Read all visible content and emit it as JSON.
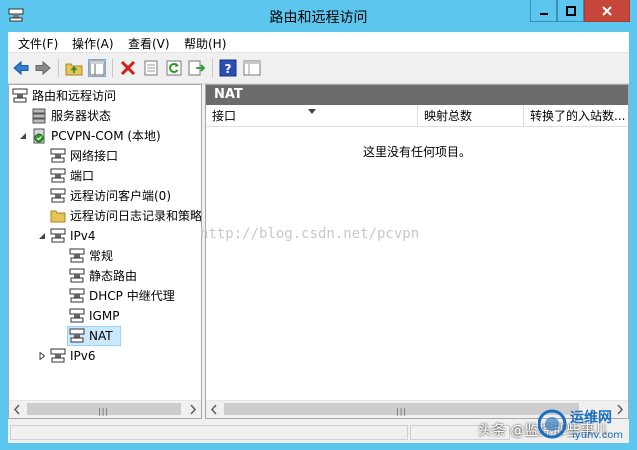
{
  "window": {
    "title": "路由和远程访问"
  },
  "menubar": {
    "items": [
      {
        "label": "文件(F)"
      },
      {
        "label": "操作(A)"
      },
      {
        "label": "查看(V)"
      },
      {
        "label": "帮助(H)"
      }
    ]
  },
  "toolbar": {
    "icons": [
      "back-arrow-icon",
      "forward-arrow-icon",
      "up-folder-icon",
      "show-hide-tree-icon",
      "delete-icon",
      "properties-icon",
      "refresh-icon",
      "export-list-icon",
      "help-icon",
      "console-pane-icon"
    ]
  },
  "tree": {
    "root": "路由和远程访问",
    "server_status": "服务器状态",
    "server": "PCVPN-COM (本地)",
    "network_interfaces": "网络接口",
    "ports": "端口",
    "remote_clients": "远程访问客户端(0)",
    "remote_logging": "远程访问日志记录和策略",
    "ipv4": "IPv4",
    "general": "常规",
    "static_routes": "静态路由",
    "dhcp_relay": "DHCP 中继代理",
    "igmp": "IGMP",
    "nat": "NAT",
    "ipv6": "IPv6"
  },
  "right_pane": {
    "header": "NAT",
    "columns": [
      "接口",
      "映射总数",
      "转换了的入站数..."
    ],
    "empty_message": "这里没有任何项目。"
  },
  "overlay": {
    "watermark": "http://blog.csdn.net/pcvpn",
    "credit": "头条 @监控那些事儿",
    "logo_text": "运维网",
    "logo_url": "iyunv.com"
  },
  "colors": {
    "titlebar": "#5cc6ee",
    "close": "#c7463c",
    "header_band": "#6b6b6b",
    "selection": "#cce8ff"
  }
}
